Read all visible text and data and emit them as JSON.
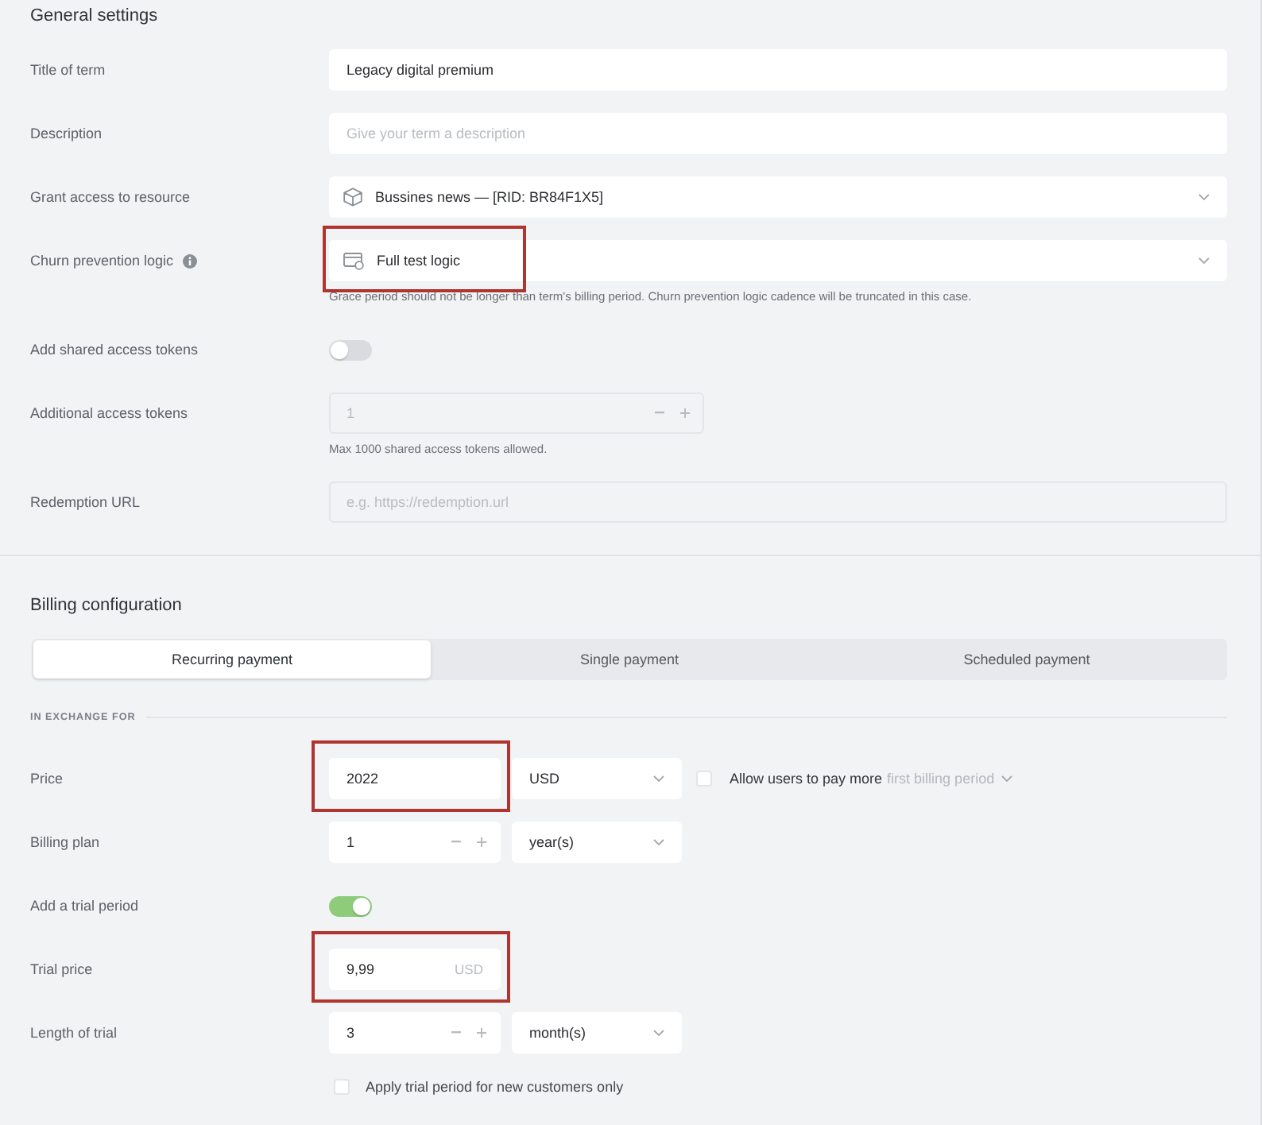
{
  "general_settings": {
    "title": "General settings",
    "rows": [
      {
        "kind": "input",
        "label": "Title of term",
        "value": "Legacy digital premium",
        "disabled": false,
        "highlighted": false
      },
      {
        "kind": "input",
        "label": "Description",
        "placeholder": "Give your term a description",
        "disabled": false,
        "highlighted": false
      },
      {
        "kind": "resource",
        "label": "Grant access to resource",
        "value": "Bussines news — [RID: BR84F1X5]",
        "highlighted": false
      },
      {
        "kind": "logic",
        "label": "Churn prevention logic",
        "info_icon": true,
        "value": "Full test logic",
        "hint": "Grace period should not be longer than term's billing period. Churn prevention logic cadence will be truncated in this case.",
        "highlighted": true
      },
      {
        "kind": "toggle",
        "label": "Add shared access tokens",
        "on": false
      },
      {
        "kind": "counter",
        "label": "Additional access tokens",
        "value": "1",
        "disabled": true,
        "hint": "Max 1000 shared access tokens allowed.",
        "highlighted": false
      },
      {
        "kind": "input",
        "label": "Redemption URL",
        "placeholder": "e.g. https://redemption.url",
        "disabled": true,
        "highlighted": false
      }
    ]
  },
  "billing_configuration": {
    "title": "Billing configuration",
    "tabs": [
      {
        "label": "Recurring payment",
        "selected": true
      },
      {
        "label": "Single payment",
        "selected": false
      },
      {
        "label": "Scheduled payment",
        "selected": false
      }
    ],
    "group_label": "IN EXCHANGE FOR",
    "rows": [
      {
        "kind": "price",
        "label": "Price",
        "value": "2022",
        "highlighted": true,
        "currency": "USD",
        "pay_more": {
          "checked": false,
          "label": "Allow users to pay more",
          "period": "first billing period"
        }
      },
      {
        "kind": "plan",
        "label": "Billing plan",
        "value": "1",
        "unit": "year(s)",
        "highlighted": false
      },
      {
        "kind": "toggle",
        "label": "Add a trial period",
        "on": true
      },
      {
        "kind": "suffix",
        "label": "Trial price",
        "value": "9,99",
        "suffix": "USD",
        "highlighted": true
      },
      {
        "kind": "plan",
        "label": "Length of trial",
        "value": "3",
        "unit": "month(s)",
        "highlighted": false
      },
      {
        "kind": "checkbox",
        "label": "Apply trial period for new customers only",
        "checked": false
      }
    ]
  }
}
